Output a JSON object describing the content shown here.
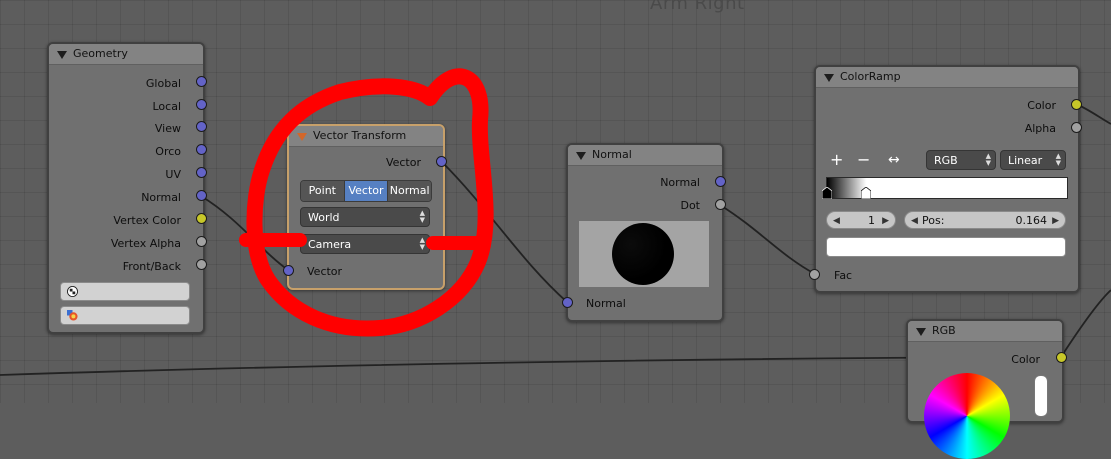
{
  "canvas_title_cut": "Arm Right",
  "colors": {
    "vector_socket": "#6363c7",
    "color_socket": "#c7c729",
    "gray_socket": "#a1a1a1",
    "selected_frame": "#c7a06a",
    "annotation_red": "#ff0000"
  },
  "geometry": {
    "title": "Geometry",
    "outputs": [
      "Global",
      "Local",
      "View",
      "Orco",
      "UV",
      "Normal",
      "Vertex Color",
      "Vertex Alpha",
      "Front/Back"
    ],
    "widget_icons": [
      "checker-icon",
      "color-wheel-icon"
    ]
  },
  "vector_transform": {
    "title": "Vector Transform",
    "output": "Vector",
    "type_options": [
      "Point",
      "Vector",
      "Normal"
    ],
    "type_selected": "Vector",
    "convert_from": "World",
    "convert_to": "Camera",
    "input": "Vector"
  },
  "normal": {
    "title": "Normal",
    "outputs": [
      "Normal",
      "Dot"
    ],
    "input": "Normal"
  },
  "colorramp": {
    "title": "ColorRamp",
    "outputs": [
      "Color",
      "Alpha"
    ],
    "add_icon": "+",
    "remove_icon": "−",
    "flip_icon": "↔",
    "color_mode": "RGB",
    "interpolation": "Linear",
    "stop_index": "1",
    "pos_label": "Pos:",
    "pos_value": "0.164",
    "pos_fraction": 0.164,
    "input": "Fac"
  },
  "rgb": {
    "title": "RGB",
    "output": "Color"
  }
}
